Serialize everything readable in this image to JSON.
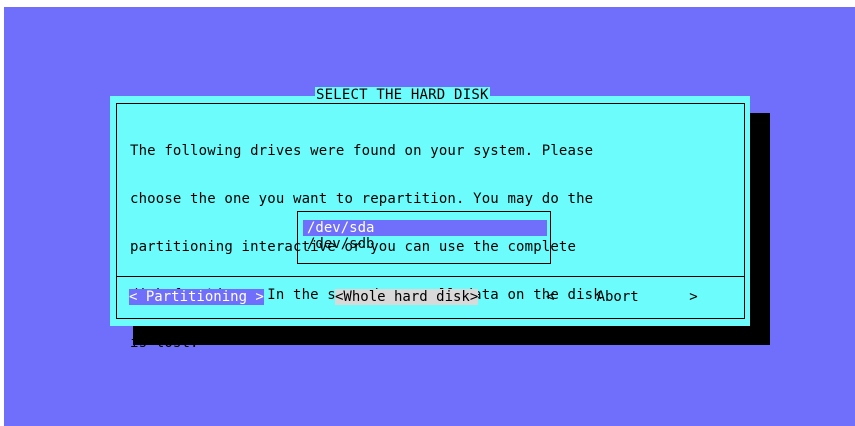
{
  "dialog": {
    "title": "SELECT THE HARD DISK",
    "message_lines": [
      "The following drives were found on your system. Please",
      "choose the one you want to repartition. You may do the",
      "partitioning interactive or you can use the complete",
      "disk for Linux. In the second case all data on the disk",
      "is lost."
    ],
    "drives": [
      "/dev/sda",
      "/dev/sdb"
    ],
    "selected_drive": "/dev/sda",
    "buttons": {
      "partitioning": "< Partitioning >",
      "whole_disk": "<Whole hard disk>",
      "abort": "<     Abort      >"
    }
  },
  "colors": {
    "background": "#6f6ffb",
    "dialog": "#6cfcfc",
    "highlight": "#6f6ffb",
    "shadow": "#000000"
  }
}
